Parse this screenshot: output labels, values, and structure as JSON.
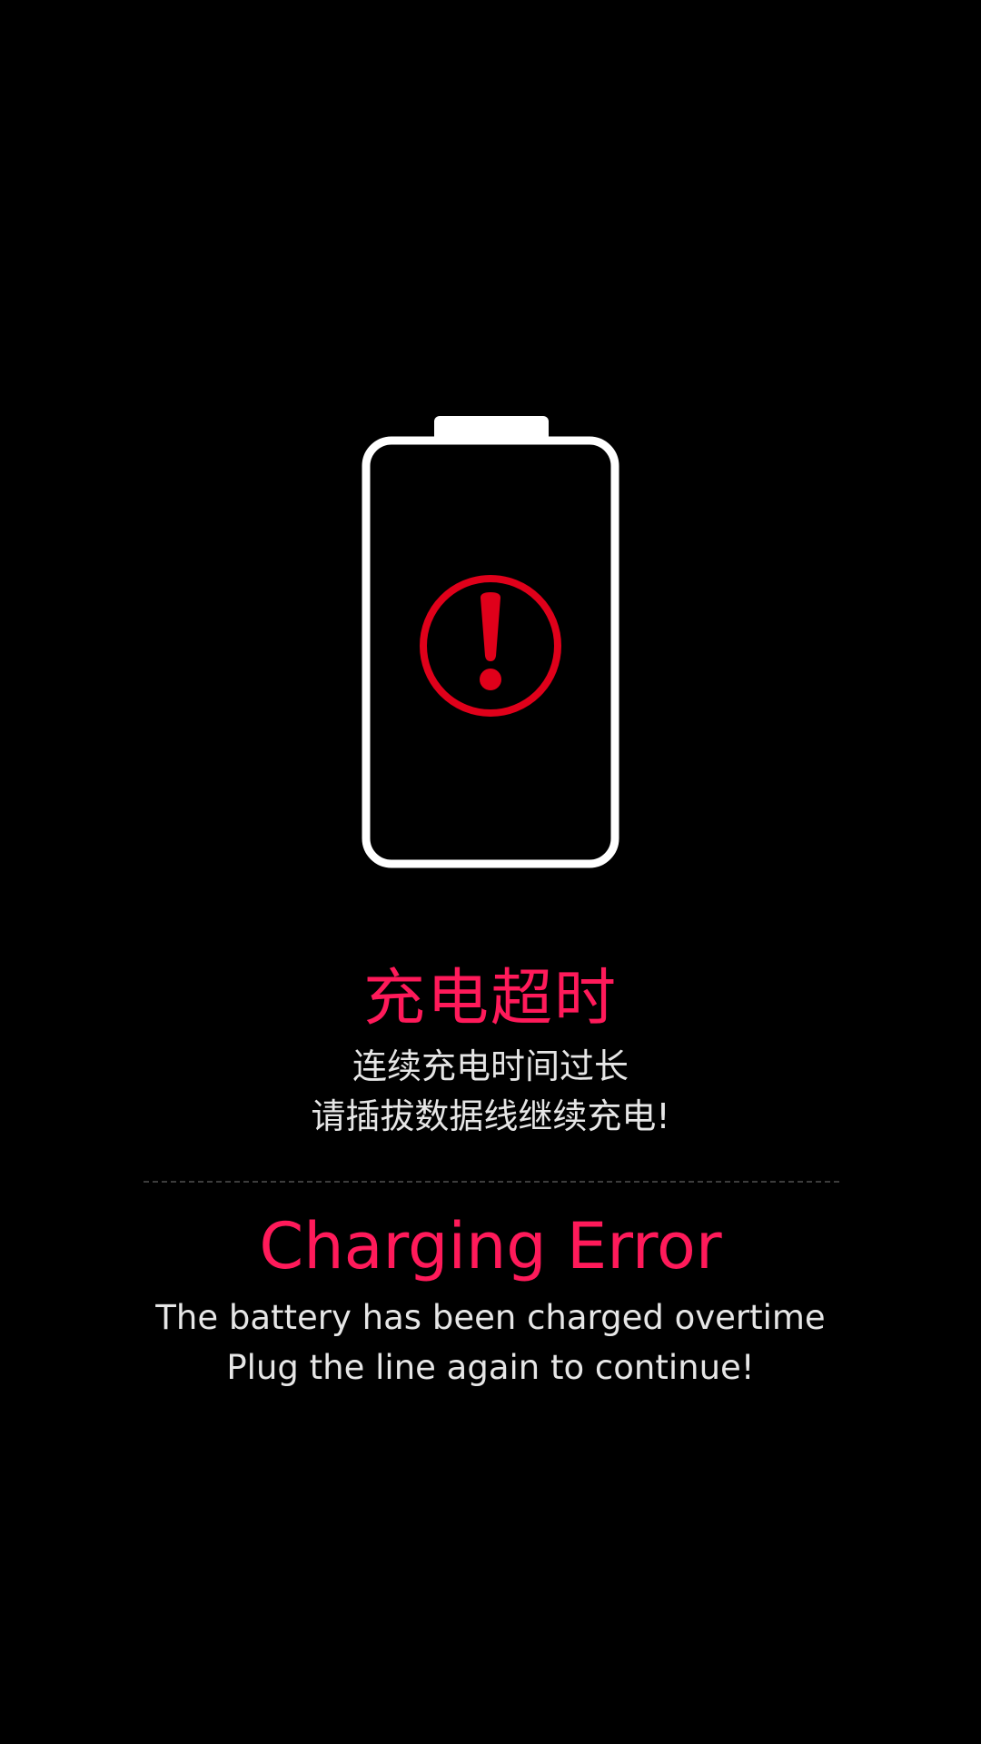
{
  "colors": {
    "background": "#000000",
    "battery_outline": "#ffffff",
    "alert_red": "#e0001a",
    "title_pink": "#ff1a5a",
    "body_text": "#e6e6e6",
    "divider": "#3c3c3c"
  },
  "icons": {
    "battery": "battery-outline-icon",
    "alert": "exclamation-circle-icon"
  },
  "cn": {
    "title": "充电超时",
    "line1": "连续充电时间过长",
    "line2": "请插拔数据线继续充电!"
  },
  "en": {
    "title": "Charging Error",
    "line1": "The battery has been charged overtime",
    "line2": "Plug the line again to continue!"
  }
}
